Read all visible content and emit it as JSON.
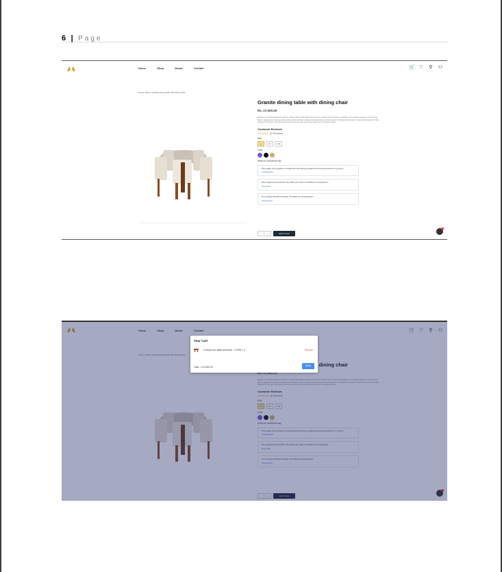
{
  "document": {
    "page_number": "6",
    "separator": "|",
    "page_word": "Page"
  },
  "site": {
    "nav_links": [
      "Home",
      "Shop",
      "About",
      "Contact"
    ],
    "icons": [
      "cart-icon",
      "heart-icon",
      "search-icon",
      "user-icon"
    ],
    "breadcrumb": "Home / Shop / Granite dining table with dining chair"
  },
  "product": {
    "title": "Granite dining table with dining chair",
    "price": "Rs. 27,000.00",
    "description": "Elevate your dining experience with the Granite Dining Table with Dining Chairs, a perfect blend of luxury, durability, and timeless elegance. The stunning table is designed to impress, crafted with a luxurious finish, making it an ideal choice for both modern and traditional interiors. Paired with ergonomic chairs designed for comfort, this dining set ensures that you and your guests enjoy hours of relaxed dining.",
    "reviews_heading": "Customer Reviews",
    "stars": "★★★★★",
    "review_count": "(3 Reviews)",
    "size_label": "Size",
    "sizes": [
      "L",
      "XL",
      "XS"
    ],
    "color_label": "Color",
    "colors": [
      "#6d5bd0",
      "#111111",
      "#c8b27a"
    ],
    "testimonials_heading": "What our customers say",
    "testimonials": [
      {
        "text": "\"The quality of the granite is exceptional! This dining set adds such a luxurious touch to my home.\"",
        "author": "- Pooja Bhandari"
      },
      {
        "text": "\"Very elegant and functional. The chairs are super comfortable for long dinners.\"",
        "author": "- Emily White"
      },
      {
        "text": "\"I'm so happy with this purchase. The table is a showstopper!\"",
        "author": "- Michael Brown"
      }
    ],
    "qty_minus": "-",
    "qty_value": "1",
    "qty_plus": "+",
    "add_to_cart": "Add To Cart"
  },
  "cart": {
    "title": "Your Cart",
    "item": "Cushion box table and chair - 13,900 × 4",
    "remove": "Remove",
    "total": "Total : 1,12,900.00",
    "button": "Show"
  },
  "colors": {
    "accent_gold": "#d4a73a",
    "dark_button": "#1f2937",
    "overlay": "#28326e",
    "cart_button": "#4a8df0",
    "remove_red": "#e53935"
  }
}
